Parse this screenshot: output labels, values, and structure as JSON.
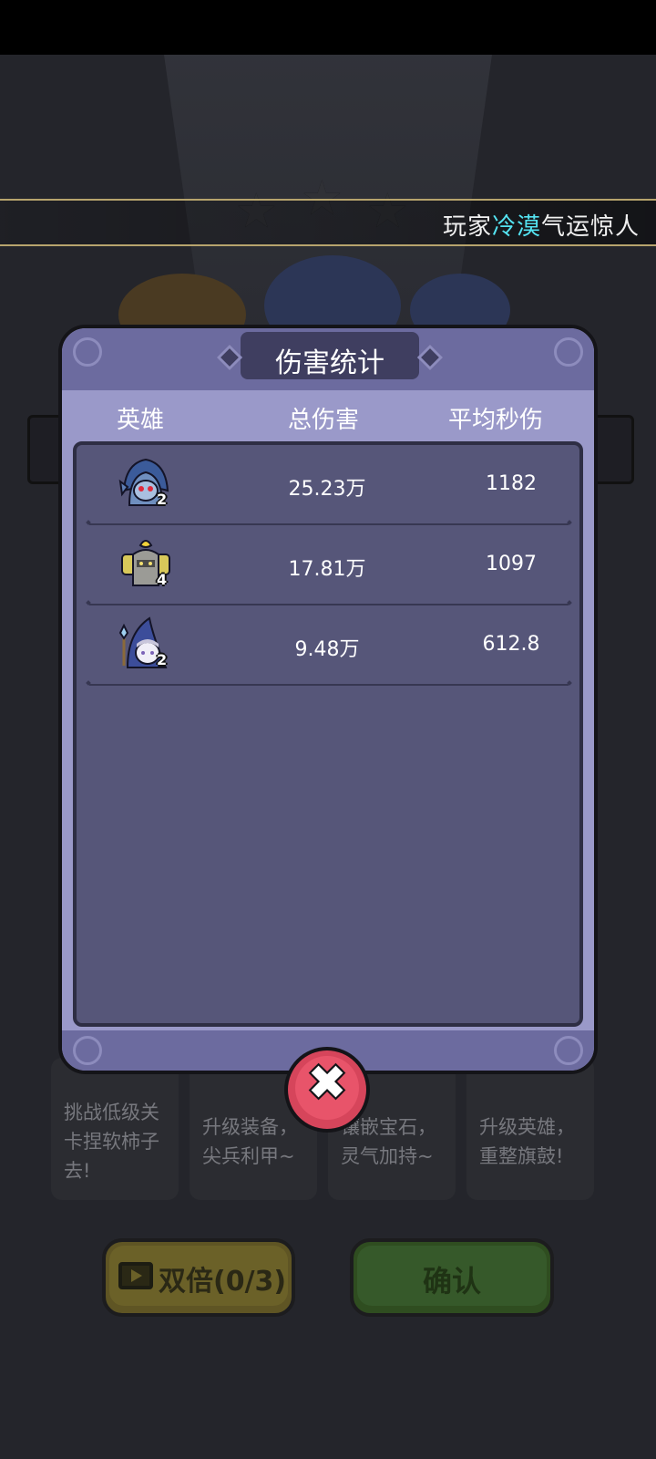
{
  "banner": {
    "prefix": "玩家",
    "player_name": "冷漠",
    "suffix": "气运惊人"
  },
  "panel": {
    "title": "伤害统计",
    "columns": [
      "英雄",
      "总伤害",
      "平均秒伤"
    ],
    "rows": [
      {
        "hero": "blue-hooded-ghost",
        "stars": "2",
        "total_damage": "25.23万",
        "avg_dps": "1182"
      },
      {
        "hero": "armored-knight",
        "stars": "4",
        "total_damage": "17.81万",
        "avg_dps": "1097"
      },
      {
        "hero": "blue-hooded-mage",
        "stars": "2",
        "total_damage": "9.48万",
        "avg_dps": "612.8"
      }
    ]
  },
  "tips": [
    "挑战低级关卡捏软柿子去!",
    "升级装备，尖兵利甲~",
    "镶嵌宝石，灵气加持~",
    "升级英雄，重整旗鼓!"
  ],
  "buttons": {
    "double": "双倍(0/3)",
    "confirm": "确认"
  },
  "colors": {
    "highlight": "#54e3f1",
    "panel": "#9a99c9",
    "close": "#e8546a"
  }
}
